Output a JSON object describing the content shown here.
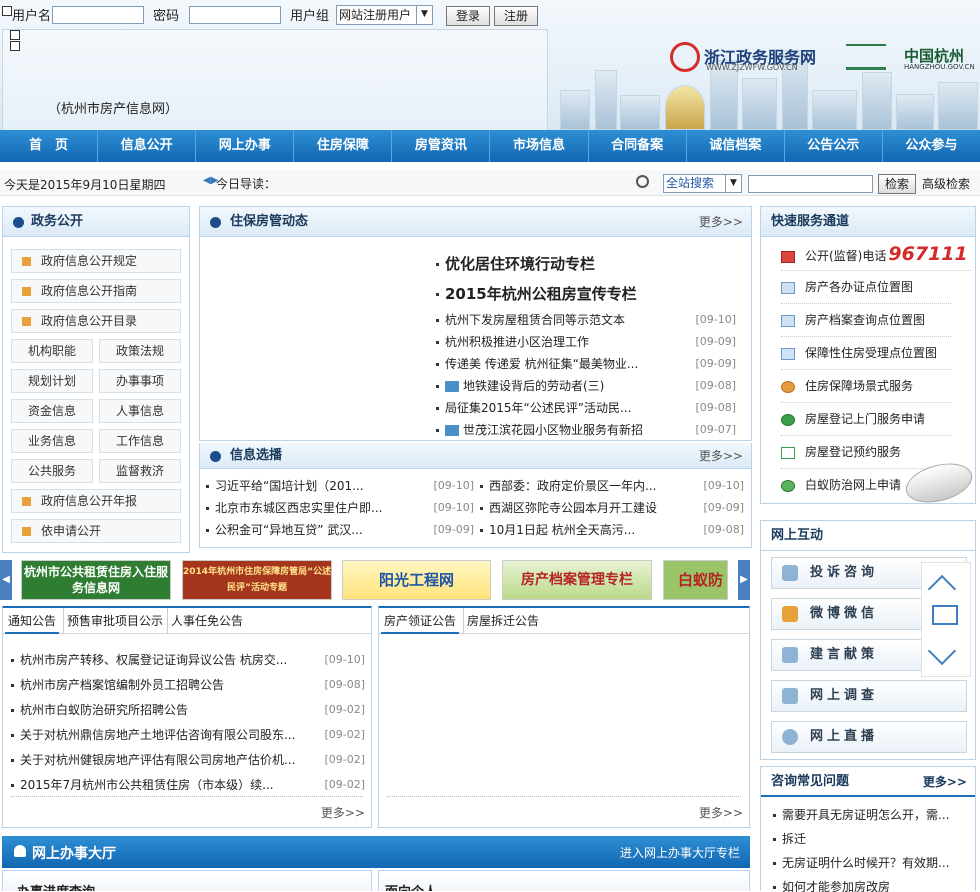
{
  "login": {
    "username_label": "用户名",
    "password_label": "密码",
    "group_label": "用户组",
    "group_value": "网站注册用户",
    "login_btn": "登录",
    "register_btn": "注册"
  },
  "header": {
    "site_name": "（杭州市房产信息网）",
    "logo_zj": "浙江政务服务网",
    "logo_zj_url": "WWW.ZJZWFW.GOV.CN",
    "logo_hz": "中国杭州",
    "logo_hz_url": "HANGZHOU.GOV.CN"
  },
  "nav": [
    "首　页",
    "信息公开",
    "网上办事",
    "住房保障",
    "房管资讯",
    "市场信息",
    "合同备案",
    "诚信档案",
    "公告公示",
    "公众参与"
  ],
  "bar": {
    "date": "今天是2015年9月10日星期四",
    "guide": "今日导读：",
    "search_scope": "全站搜索",
    "search_btn": "检索",
    "advanced": "高级检索"
  },
  "gov": {
    "title": "政务公开",
    "wide_items": [
      "政府信息公开规定",
      "政府信息公开指南",
      "政府信息公开目录"
    ],
    "grid": [
      [
        "机构职能",
        "政策法规"
      ],
      [
        "规划计划",
        "办事事项"
      ],
      [
        "资金信息",
        "人事信息"
      ],
      [
        "业务信息",
        "工作信息"
      ],
      [
        "公共服务",
        "监督救济"
      ]
    ],
    "bottom_items": [
      "政府信息公开年报",
      "依申请公开"
    ]
  },
  "news": {
    "title": "住保房管动态",
    "more": "更多>>",
    "featured": [
      "优化居住环境行动专栏",
      "2015年杭州公租房宣传专栏"
    ],
    "items": [
      {
        "text": "杭州下发房屋租赁合同等示范文本",
        "date": "[09-10]",
        "img": false
      },
      {
        "text": "杭州积极推进小区治理工作",
        "date": "[09-09]",
        "img": false
      },
      {
        "text": "传递美 传递爱 杭州征集“最美物业...",
        "date": "[09-09]",
        "img": false
      },
      {
        "text": "地铁建设背后的劳动者(三)",
        "date": "[09-08]",
        "img": true
      },
      {
        "text": "局征集2015年“公述民评”活动民...",
        "date": "[09-08]",
        "img": false
      },
      {
        "text": "世茂江滨花园小区物业服务有新招",
        "date": "[09-07]",
        "img": true
      }
    ]
  },
  "select": {
    "title": "信息选播",
    "more": "更多>>",
    "left": [
      {
        "text": "习近平给“国培计划（201...",
        "date": "[09-10]"
      },
      {
        "text": "北京市东城区西忠实里住户即...",
        "date": "[09-10]"
      },
      {
        "text": "公积金可“异地互贷” 武汉...",
        "date": "[09-09]"
      }
    ],
    "right": [
      {
        "text": "西部委：政府定价景区一年内...",
        "date": "[09-10]"
      },
      {
        "text": "西湖区弥陀寺公园本月开工建设",
        "date": "[09-09]"
      },
      {
        "text": "10月1日起 杭州全天高污...",
        "date": "[09-08]"
      }
    ]
  },
  "quick": {
    "title": "快速服务通道",
    "phone_label": "公开(监督)电话",
    "phone": "967111",
    "items": [
      "房产各办证点位置图",
      "房产档案查询点位置图",
      "保障性住房受理点位置图",
      "住房保障场景式服务",
      "房屋登记上门服务申请",
      "房屋登记预约服务",
      "白蚁防治网上申请"
    ]
  },
  "interact": {
    "title": "网上互动",
    "items": [
      "投诉咨询",
      "微博微信",
      "建言献策",
      "网上调查",
      "网上直播"
    ]
  },
  "banners": [
    "杭州市公共租赁住房入住服务信息网",
    "2014年杭州市住房保障房管局“公述民评”活动专题",
    "阳光工程网",
    "房产档案管理专栏",
    "白蚁防"
  ],
  "notice": {
    "tabs": [
      "通知公告",
      "预售审批项目公示",
      "人事任免公告"
    ],
    "more": "更多>>",
    "items": [
      {
        "text": "杭州市房产转移、权属登记证询异议公告 杭房交...",
        "date": "[09-10]"
      },
      {
        "text": "杭州市房产档案馆编制外员工招聘公告",
        "date": "[09-08]"
      },
      {
        "text": "杭州市白蚁防治研究所招聘公告",
        "date": "[09-02]"
      },
      {
        "text": "关于对杭州鼎信房地产土地评估咨询有限公司股东...",
        "date": "[09-02]"
      },
      {
        "text": "关于对杭州健银房地产评估有限公司房地产估价机...",
        "date": "[09-02]"
      },
      {
        "text": "2015年7月杭州市公共租赁住房（市本级）续...",
        "date": "[09-02]"
      }
    ]
  },
  "cert": {
    "tabs": [
      "房产领证公告",
      "房屋拆迁公告"
    ],
    "more": "更多>>"
  },
  "faq": {
    "title": "咨询常见问题",
    "more": "更多>>",
    "items": [
      "需要开具无房证明怎么开，需...",
      "拆迁",
      "无房证明什么时候开？有效期...",
      "如何才能参加房改房"
    ]
  },
  "hall": {
    "title": "网上办事大厅",
    "link": "进入网上办事大厅专栏",
    "sub_left": "办事进度查询",
    "sub_right": "面向个人"
  },
  "colors": {
    "nav": "#1a73bf",
    "accent_phone": "#d42a2a",
    "panel_border": "#b8d3ea"
  }
}
